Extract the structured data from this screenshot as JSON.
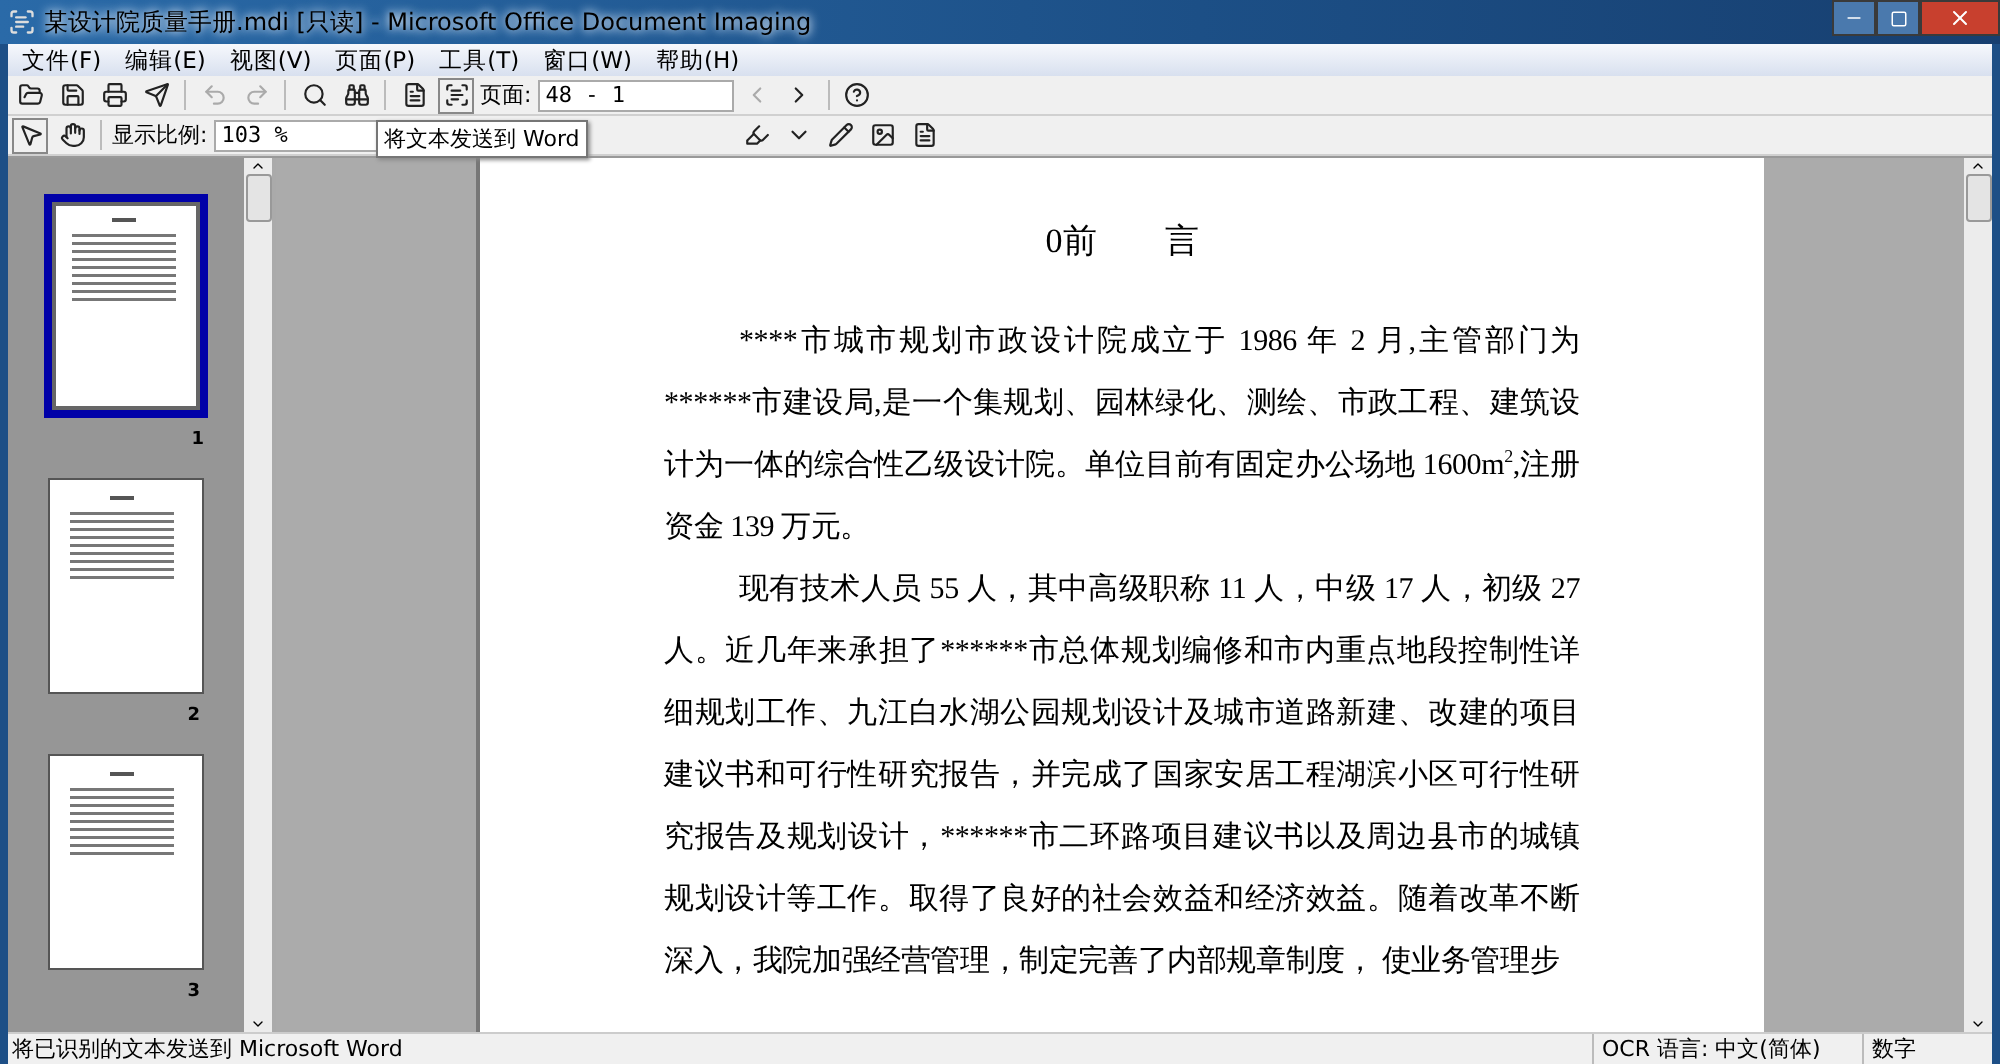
{
  "window": {
    "title": "某设计院质量手册.mdi [只读] - Microsoft Office Document Imaging"
  },
  "menu": [
    {
      "label": "文件(F)"
    },
    {
      "label": "编辑(E)"
    },
    {
      "label": "视图(V)"
    },
    {
      "label": "页面(P)"
    },
    {
      "label": "工具(T)"
    },
    {
      "label": "窗口(W)"
    },
    {
      "label": "帮助(H)"
    }
  ],
  "toolbar": {
    "page_label": "页面:",
    "page_value": "48 - 1"
  },
  "toolbar2": {
    "zoom_label": "显示比例:",
    "zoom_value": "103 %",
    "tooltip": "将文本发送到 Word"
  },
  "thumbnails": [
    {
      "number": "1",
      "selected": true
    },
    {
      "number": "2",
      "selected": false
    },
    {
      "number": "3",
      "selected": false
    }
  ],
  "document": {
    "title": "0前　　言",
    "first_paragraph": {
      "before": "****市城市规划市政设计院成立于 1986 年 2 月,主管部门为******市建设局,是一个集规划、园林绿化、测绘、市政工程、建筑设计为一体的综合性乙级设计院。单位目前有固定办公场地 1600m",
      "superscript": "2",
      "after": ",注册资金 139 万元。"
    },
    "paragraphs": [
      "现有技术人员 55 人，其中高级职称 11 人，中级 17 人，初级 27 人。近几年来承担了******市总体规划编修和市内重点地段控制性详细规划工作、九江白水湖公园规划设计及城市道路新建、改建的项目建议书和可行性研究报告，并完成了国家安居工程湖滨小区可行性研究报告及规划设计，******市二环路项目建议书以及周边县市的城镇规划设计等工作。取得了良好的社会效益和经济效益。随着改革不断深入，我院加强经营管理，制定完善了内部规章制度， 使业务管理步"
    ]
  },
  "status_bar": {
    "message": "将已识别的文本发送到 Microsoft Word",
    "ocr_language": "OCR 语言: 中文(简体)",
    "mode": "数字"
  }
}
